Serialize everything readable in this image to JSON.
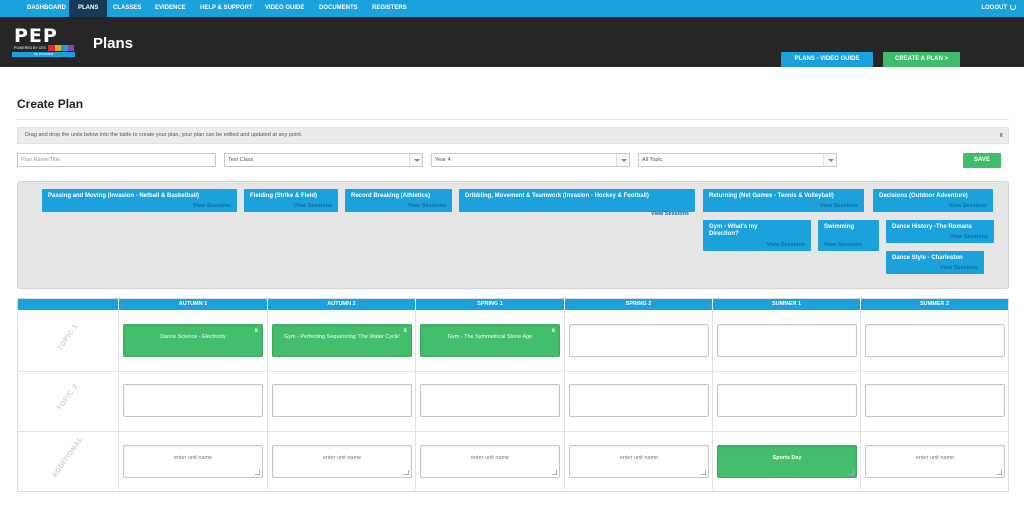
{
  "nav": {
    "items": [
      "DASHBOARD",
      "PLANS",
      "CLASSES",
      "EVIDENCE",
      "HELP & SUPPORT",
      "VIDEO GUIDE",
      "DOCUMENTS",
      "REGISTERS"
    ],
    "active": "PLANS",
    "logout": "LOGOUT"
  },
  "header": {
    "logo_text": "PEP",
    "logo_powered": "POWERED BY CES",
    "logo_bar": "PE PLANNER",
    "title": "Plans",
    "video_button": "PLANS - VIDEO GUIDE",
    "create_button": "CREATE A PLAN >"
  },
  "create": {
    "heading": "Create Plan",
    "instructions": "Drag and drop the units below into the table to create your plan, your plan can be edited and updated at any point.",
    "close": "x",
    "name_placeholder": "Plan Name/Title",
    "class_value": "Test Class",
    "year_value": "Year 4",
    "topic_value": "All Topic",
    "save": "SAVE"
  },
  "units": [
    {
      "title": "Passing and Moving (Invasion - Netball & Basketball)",
      "link": "View Sessions"
    },
    {
      "title": "Fielding (Strike & Field)",
      "link": "View Sessions"
    },
    {
      "title": "Record Breaking (Athletics)",
      "link": "View Sessions"
    },
    {
      "title": "Dribbling, Movement & Teamwork (Invasion - Hockey & Football)",
      "link": "View Sessions"
    },
    {
      "title": "Returning (Net Games - Tennis & Volleyball)",
      "link": "View Sessions"
    },
    {
      "title": "Decisions (Outdoor Adventure)",
      "link": "View Sessions"
    },
    {
      "title": "Gym - What's my Direction?",
      "link": "View Sessions"
    },
    {
      "title": "Swimming",
      "link": "View Sessions"
    },
    {
      "title": "Dance History -The Romans",
      "link": "View Sessions"
    },
    {
      "title": "Dance Style - Charleston",
      "link": "View Sessions"
    }
  ],
  "table": {
    "columns": [
      "AUTUMN 1",
      "AUTUMN 2",
      "SPRING 1",
      "SPRING 2",
      "SUMMER 1",
      "SUMMER 2"
    ],
    "rows": [
      "TOPIC 1",
      "TOPIC 2",
      "ADDITIONAL"
    ],
    "topic1": [
      "Dance Science - Electricity",
      "Gym - Perfecting Sequencing 'The Water Cycle'",
      "Gym - The Symmetrical Stone Age",
      "",
      "",
      ""
    ],
    "topic2": [
      "",
      "",
      "",
      "",
      "",
      ""
    ],
    "additional": [
      "enter unit name",
      "enter unit name",
      "enter unit name",
      "enter unit name",
      "Sports Day",
      "enter unit name"
    ],
    "remove": "x"
  },
  "colors": {
    "primary": "#1ba1dc",
    "success": "#44bd6c",
    "dark": "#262626",
    "navActive": "#153b57"
  }
}
